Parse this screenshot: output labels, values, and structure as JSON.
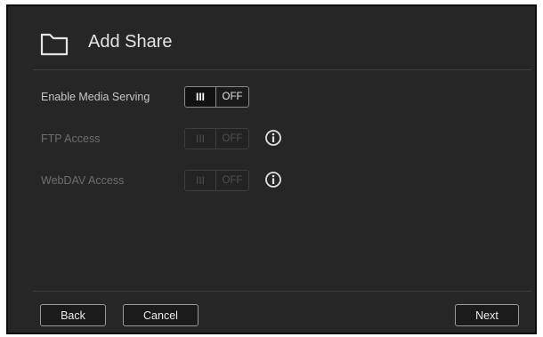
{
  "dialog": {
    "title": "Add Share",
    "icon": "folder-icon"
  },
  "settings": [
    {
      "label": "Enable Media Serving",
      "on_label": "III",
      "off_label": "OFF",
      "state": "off",
      "enabled": true,
      "has_info": false
    },
    {
      "label": "FTP Access",
      "on_label": "III",
      "off_label": "OFF",
      "state": "off",
      "enabled": false,
      "has_info": true
    },
    {
      "label": "WebDAV Access",
      "on_label": "III",
      "off_label": "OFF",
      "state": "off",
      "enabled": false,
      "has_info": true
    }
  ],
  "footer": {
    "back_label": "Back",
    "cancel_label": "Cancel",
    "next_label": "Next"
  },
  "colors": {
    "background": "#262626",
    "text": "#e3e3e3",
    "disabled_text": "#6e6e6e",
    "border": "#8a8a8a"
  }
}
